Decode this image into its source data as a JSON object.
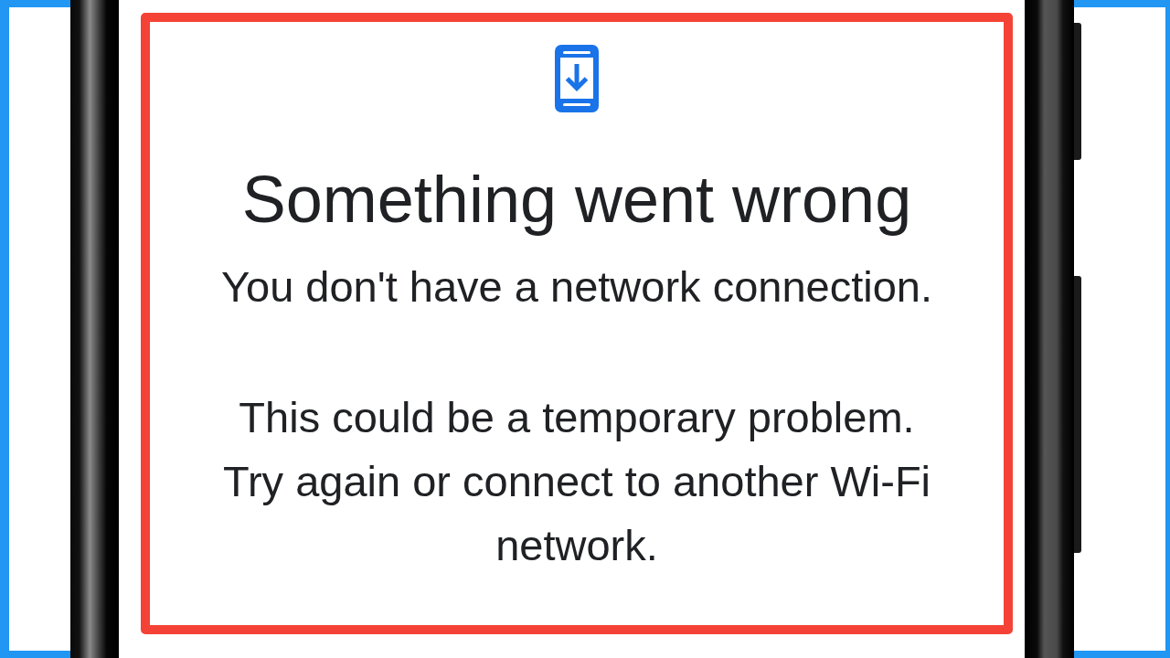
{
  "dialog": {
    "title": "Something went wrong",
    "message": "You don't have a network connection.",
    "detail": "This could be a temporary problem. Try again or connect to another Wi-Fi network."
  }
}
